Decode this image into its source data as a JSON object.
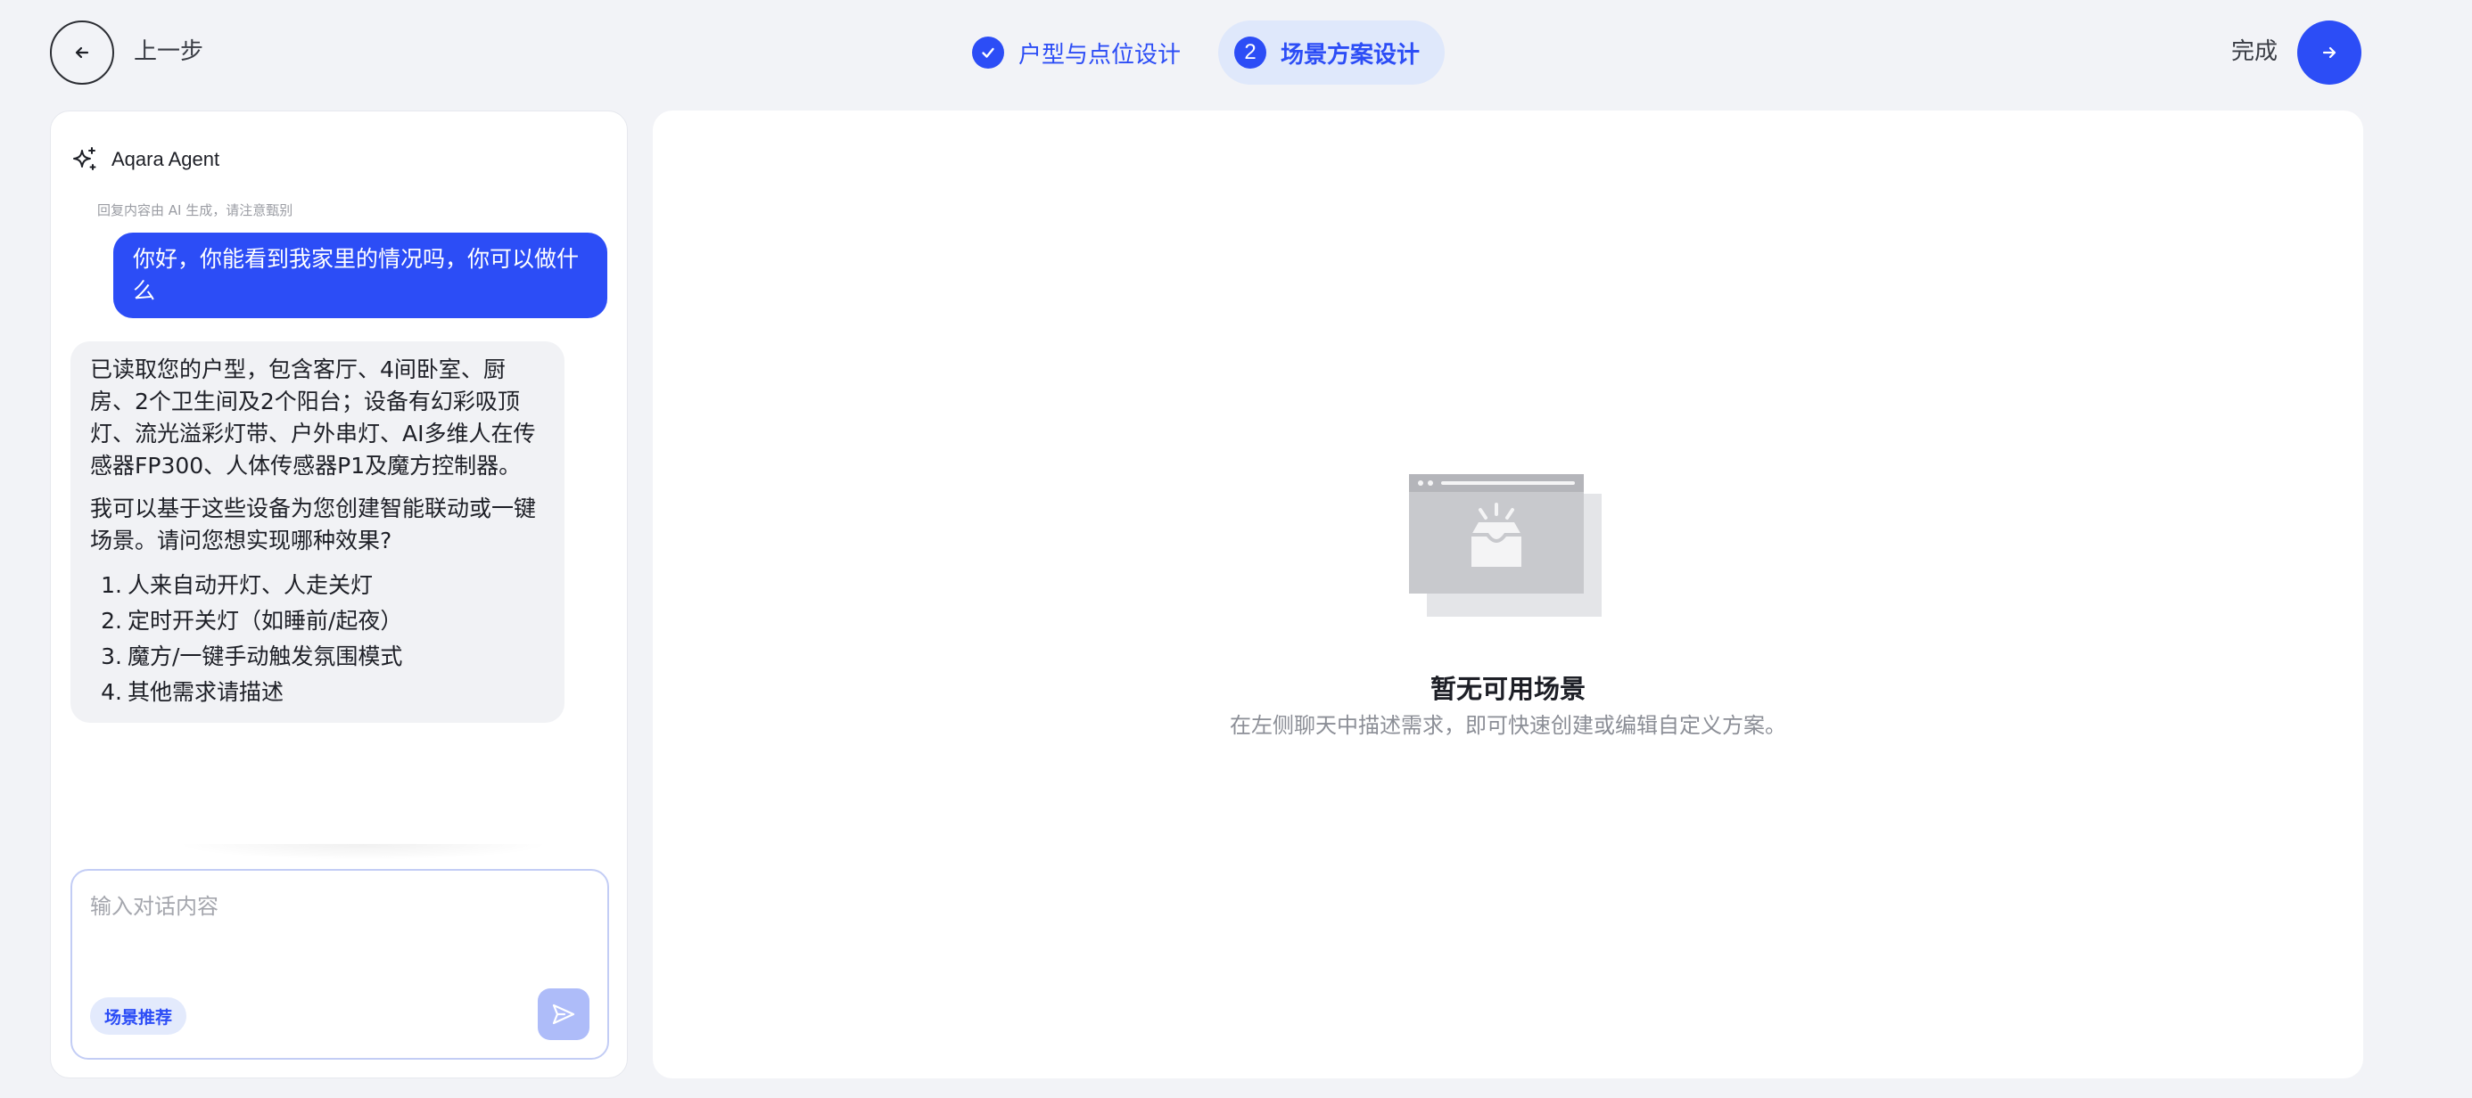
{
  "topbar": {
    "back_label": "上一步",
    "finish_label": "完成",
    "steps": [
      {
        "number": "1",
        "label": "户型与点位设计",
        "state": "done"
      },
      {
        "number": "2",
        "label": "场景方案设计",
        "state": "active"
      }
    ]
  },
  "chat": {
    "agent_name": "Aqara Agent",
    "ai_notice": "回复内容由 AI 生成，请注意甄别",
    "user_message": "你好，你能看到我家里的情况吗，你可以做什么",
    "bot_reply": {
      "paragraph_1": "已读取您的户型，包含客厅、4间卧室、厨房、2个卫生间及2个阳台；设备有幻彩吸顶灯、流光溢彩灯带、户外串灯、AI多维人在传感器FP300、人体传感器P1及魔方控制器。",
      "paragraph_2": "我可以基于这些设备为您创建智能联动或一键场景。请问您想实现哪种效果?",
      "options": [
        {
          "num": "1.",
          "text": "人来自动开灯、人走关灯"
        },
        {
          "num": "2.",
          "text": "定时开关灯（如睡前/起夜）"
        },
        {
          "num": "3.",
          "text": "魔方/一键手动触发氛围模式"
        },
        {
          "num": "4.",
          "text": "其他需求请描述"
        }
      ]
    },
    "input": {
      "placeholder": "输入对话内容",
      "value": ""
    },
    "scene_chip_label": "场景推荐"
  },
  "scene_panel": {
    "empty_title": "暂无可用场景",
    "empty_subtitle": "在左侧聊天中描述需求，即可快速创建或编辑自定义方案。"
  },
  "colors": {
    "accent": "#2c4df6",
    "accent_light": "#dfe8fb",
    "page_bg": "#f2f3f7",
    "panel_bg": "#ffffff",
    "bot_bubble_bg": "#f1f2f5",
    "send_disabled": "#aebcf9"
  },
  "icons": {
    "back": "arrow-left-icon",
    "next": "arrow-right-icon",
    "step_done": "check-icon",
    "agent": "sparkle-icon",
    "send": "send-icon",
    "empty": "empty-inbox-illustration"
  }
}
